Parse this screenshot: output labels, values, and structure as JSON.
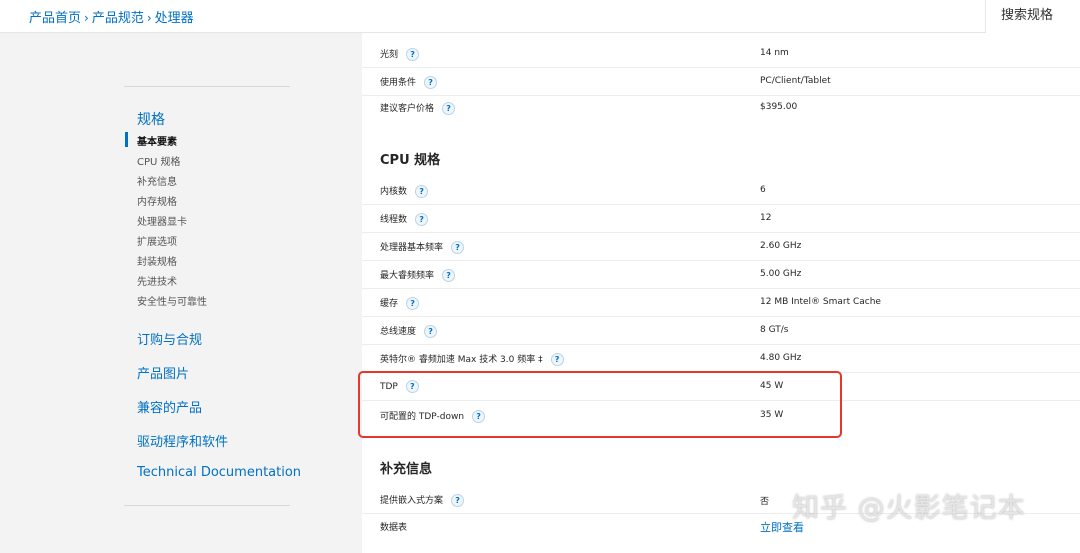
{
  "breadcrumb": {
    "items": [
      "产品首页",
      "产品规范",
      "处理器"
    ],
    "separator": "›"
  },
  "header": {
    "search_label": "搜索规格"
  },
  "sidebar": {
    "group_title": "规格",
    "sub_items": [
      "基本要素",
      "CPU 规格",
      "补充信息",
      "内存规格",
      "处理器显卡",
      "扩展选项",
      "封装规格",
      "先进技术",
      "安全性与可靠性"
    ],
    "active_index": 0,
    "links": [
      "订购与合规",
      "产品图片",
      "兼容的产品",
      "驱动程序和软件",
      "Technical Documentation"
    ]
  },
  "sections": {
    "basic_rows": [
      {
        "label": "光刻",
        "value": "14 nm"
      },
      {
        "label": "使用条件",
        "value": "PC/Client/Tablet"
      },
      {
        "label": "建议客户价格",
        "value": "$395.00"
      }
    ],
    "cpu_title": "CPU 规格",
    "cpu_rows": [
      {
        "label": "内核数",
        "value": "6"
      },
      {
        "label": "线程数",
        "value": "12"
      },
      {
        "label": "处理器基本频率",
        "value": "2.60 GHz"
      },
      {
        "label": "最大睿频频率",
        "value": "5.00 GHz"
      },
      {
        "label": "缓存",
        "value": "12 MB Intel® Smart Cache"
      },
      {
        "label": "总线速度",
        "value": "8 GT/s"
      },
      {
        "label": "英特尔® 睿频加速 Max 技术 3.0 频率 ‡",
        "value": "4.80 GHz"
      },
      {
        "label": "TDP",
        "value": "45 W"
      },
      {
        "label": "可配置的 TDP-down",
        "value": "35 W"
      }
    ],
    "extra_title": "补充信息",
    "extra_rows": [
      {
        "label": "提供嵌入式方案",
        "value": "否"
      },
      {
        "label": "数据表",
        "value": "立即查看"
      }
    ]
  },
  "help_glyph": "?",
  "watermark": "知乎 @火影笔记本",
  "colors": {
    "accent": "#0071c5",
    "highlight": "#e5372b"
  }
}
